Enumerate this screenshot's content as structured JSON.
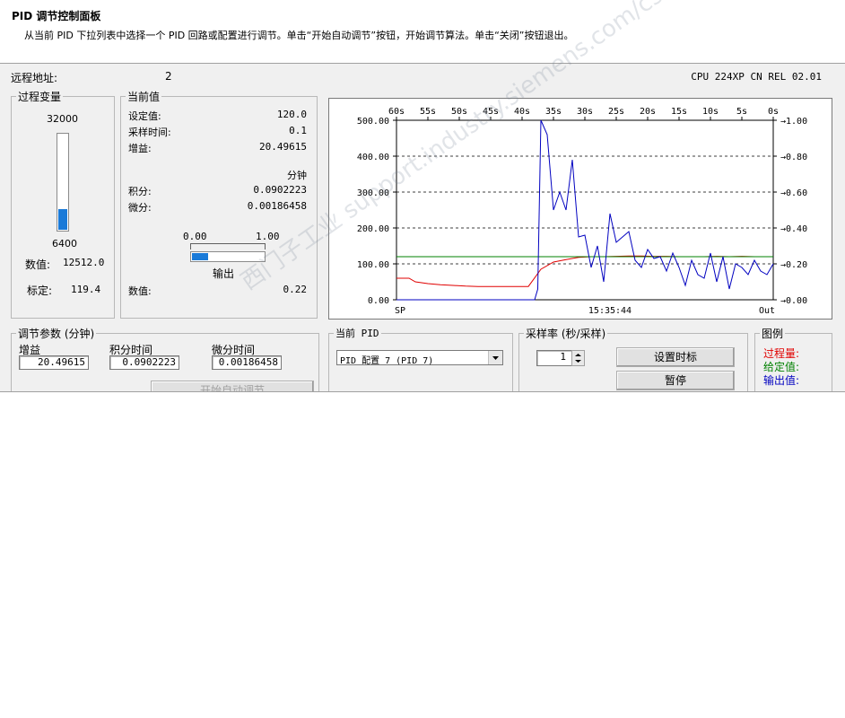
{
  "header": {
    "title": "PID 调节控制面板",
    "description": "从当前 PID 下拉列表中选择一个 PID 回路或配置进行调节。单击“开始自动调节”按钮，开始调节算法。单击“关闭”按钮退出。"
  },
  "remote": {
    "label": "远程地址:",
    "value": "2"
  },
  "cpu": "CPU 224XP CN REL 02.01",
  "process_variable": {
    "group_label": "过程变量",
    "max": "32000",
    "min": "6400",
    "level_fraction": 0.22,
    "value_label": "数值:",
    "value": "12512.0",
    "scaled_label": "标定:",
    "scaled_value": "119.4"
  },
  "current_values": {
    "group_label": "当前值",
    "setpoint_label": "设定值:",
    "setpoint": "120.0",
    "sample_time_label": "采样时间:",
    "sample_time": "0.1",
    "gain_label": "增益:",
    "gain": "20.49615",
    "minutes_label": "分钟",
    "integral_label": "积分:",
    "integral": "0.0902223",
    "derivative_label": "微分:",
    "derivative": "0.00186458",
    "output_min": "0.00",
    "output_max": "1.00",
    "output_fraction": 0.22,
    "output_label": "输出",
    "value_label": "数值:",
    "output_value": "0.22"
  },
  "tuning": {
    "group_label": "调节参数 (分钟)",
    "gain_label": "增益",
    "gain": "20.49615",
    "integral_label": "积分时间",
    "integral": "0.0902223",
    "derivative_label": "微分时间",
    "derivative": "0.00186458",
    "auto_tune_button": "开始自动调节"
  },
  "current_pid": {
    "group_label": "当前 PID",
    "selected": "PID 配置 7 (PID 7)"
  },
  "sampling": {
    "group_label": "采样率 (秒/采样)",
    "rate": "1",
    "set_time_button": "设置时标",
    "pause_button": "暂停"
  },
  "legend": {
    "group_label": "图例",
    "process_label": "过程量:",
    "setpoint_label": "给定值:",
    "output_label": "输出值:"
  },
  "colors": {
    "process": "#e00000",
    "setpoint": "#008000",
    "output": "#0000c0",
    "bar_fill": "#1a7ad8"
  },
  "watermark": "西门子工业 support.industry.siemens.com/cs",
  "chart_data": {
    "type": "line",
    "top_ticks": [
      "60s",
      "55s",
      "50s",
      "45s",
      "40s",
      "35s",
      "30s",
      "25s",
      "20s",
      "15s",
      "10s",
      "5s",
      "0s"
    ],
    "left_ticks": [
      "500.00",
      "400.00",
      "300.00",
      "200.00",
      "100.00",
      "0.00"
    ],
    "right_ticks": [
      "1.00",
      "0.80",
      "0.60",
      "0.40",
      "0.20",
      "0.00"
    ],
    "left_ylim": [
      0,
      500
    ],
    "right_ylim": [
      0,
      1
    ],
    "xlim": [
      60,
      0
    ],
    "bottom_left_label": "SP",
    "bottom_center_label": "15:35:44",
    "bottom_right_label": "Out",
    "series": [
      {
        "color": "#e00000",
        "axis": "left",
        "x": [
          60,
          58,
          57,
          55,
          53,
          51,
          49,
          47,
          45,
          43,
          40,
          39,
          37,
          35,
          33,
          31,
          29,
          27,
          25,
          23,
          21,
          19,
          17,
          15,
          13,
          11,
          9,
          7,
          5,
          3,
          1,
          0
        ],
        "y": [
          60,
          60,
          50,
          45,
          42,
          40,
          38,
          37,
          37,
          37,
          37,
          37,
          85,
          105,
          112,
          118,
          120,
          120,
          121,
          122,
          122,
          121,
          121,
          120,
          120,
          120,
          121,
          120,
          121,
          120,
          120,
          120
        ]
      },
      {
        "color": "#008000",
        "axis": "left",
        "x": [
          60,
          0
        ],
        "y": [
          120,
          120
        ]
      },
      {
        "color": "#0000c0",
        "axis": "right",
        "x": [
          60,
          38,
          37.5,
          37,
          36,
          35,
          34,
          33,
          32,
          31,
          30,
          29,
          28,
          27,
          26,
          25,
          24,
          23,
          22,
          21,
          20,
          19,
          18,
          17,
          16,
          15,
          14,
          13,
          12,
          11,
          10,
          9,
          8,
          7,
          6,
          5,
          4,
          3,
          2,
          1,
          0
        ],
        "y": [
          0,
          0,
          0.06,
          1.0,
          0.92,
          0.5,
          0.6,
          0.5,
          0.78,
          0.35,
          0.36,
          0.18,
          0.3,
          0.1,
          0.48,
          0.32,
          0.35,
          0.38,
          0.22,
          0.18,
          0.28,
          0.23,
          0.24,
          0.16,
          0.26,
          0.18,
          0.08,
          0.22,
          0.14,
          0.12,
          0.26,
          0.1,
          0.24,
          0.06,
          0.2,
          0.18,
          0.14,
          0.22,
          0.16,
          0.14,
          0.2
        ]
      }
    ]
  }
}
